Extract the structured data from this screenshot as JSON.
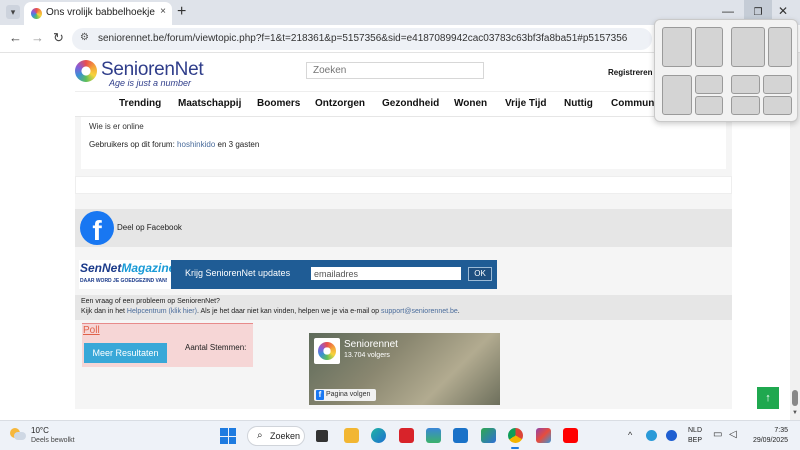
{
  "browser": {
    "tab_title": "Ons vrolijk babbelhoekje anno",
    "tab_close": "×",
    "new_tab": "+",
    "url": "seniorennet.be/forum/viewtopic.php?f=1&t=218361&p=5157356&sid=e4187089942cac03783c63bf3fa8ba51#p5157356",
    "nav": {
      "back": "←",
      "forward": "→",
      "reload": "↻"
    },
    "window": {
      "minimize": "—",
      "restore": "❐",
      "close": "✕"
    }
  },
  "site": {
    "logo_name": "SeniorenNet",
    "logo_tagline": "Age is just a number",
    "search_placeholder": "Zoeken",
    "register": "Registreren",
    "nav_items": [
      "Trending",
      "Maatschappij",
      "Boomers",
      "Ontzorgen",
      "Gezondheid",
      "Wonen",
      "Vrije Tijd",
      "Nuttig",
      "Communi"
    ]
  },
  "online": {
    "title": "Wie is er online",
    "prefix": "Gebruikers op dit forum: ",
    "user": "hoshinkido",
    "suffix": " en 3 gasten"
  },
  "share": {
    "facebook_glyph": "f",
    "facebook_label": "Deel op Facebook"
  },
  "newsletter": {
    "mag_title_a": "SenNet",
    "mag_title_b": "Magazine",
    "mag_sub": "DAAR WORD JE GOEDGEZIND VAN!",
    "label": "Krijg SeniorenNet updates",
    "input_value": "emailadres",
    "ok": "OK"
  },
  "help": {
    "line1": "Een vraag of een probleem op SeniorenNet?",
    "line2_a": "Kijk dan in het ",
    "line2_link1": "Helpcentrum (klik hier)",
    "line2_b": ". Als je het daar niet kan vinden, helpen we je via e-mail op ",
    "line2_link2": "support@seniorennet.be",
    "line2_c": "."
  },
  "poll": {
    "title": "Poll",
    "button": "Meer Resultaten",
    "votes_label": "Aantal Stemmen:"
  },
  "fb_page": {
    "name": "Seniorennet",
    "followers": "13.704 volgers",
    "follow": "Pagina volgen"
  },
  "scroll_top": "↑",
  "taskbar": {
    "temp": "10°C",
    "weather": "Deels bewolkt",
    "search": "Zoeken",
    "search_icon": "⌕",
    "tray_chevron": "^",
    "lang_top": "NLD",
    "lang_bottom": "BEP",
    "time": "7:35",
    "date": "29/09/2025"
  },
  "colors": {
    "brand": "#2f3d8a",
    "newsletter_bar": "#1f5c95",
    "poll_button": "#39a8d8",
    "scroll_top": "#1fa84f",
    "facebook": "#1877f2"
  }
}
